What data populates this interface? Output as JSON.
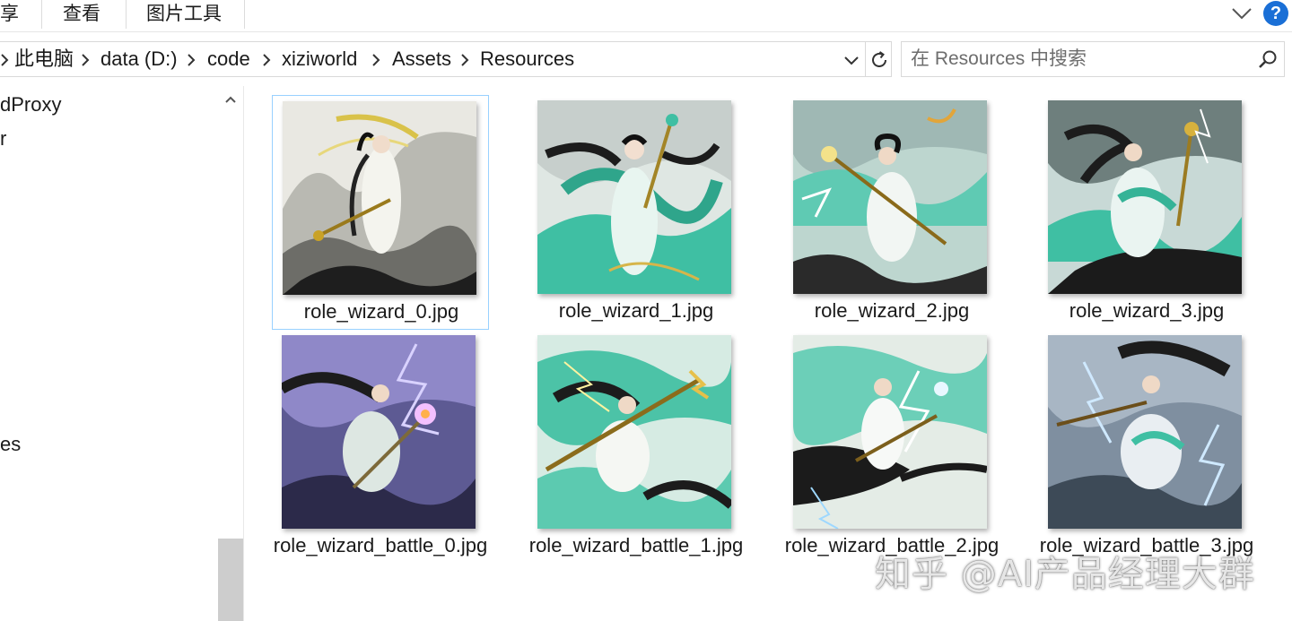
{
  "ribbon": {
    "tabs": [
      "享",
      "查看",
      "图片工具"
    ]
  },
  "address": {
    "breadcrumbs": [
      "此电脑",
      "data (D:)",
      "code",
      "xiziworld",
      "Assets",
      "Resources"
    ]
  },
  "search": {
    "placeholder": "在 Resources 中搜索"
  },
  "nav": {
    "items": [
      "dProxy",
      "r",
      "es"
    ]
  },
  "files": [
    {
      "name": "role_wizard_0.jpg"
    },
    {
      "name": "role_wizard_1.jpg"
    },
    {
      "name": "role_wizard_2.jpg"
    },
    {
      "name": "role_wizard_3.jpg"
    },
    {
      "name": "role_wizard_battle_0.jpg"
    },
    {
      "name": "role_wizard_battle_1.jpg"
    },
    {
      "name": "role_wizard_battle_2.jpg"
    },
    {
      "name": "role_wizard_battle_3.jpg"
    }
  ],
  "watermark": "知乎 @AI产品经理大群",
  "colors": {
    "accent": "#1a6fd6",
    "selection_border": "#99d1ff",
    "jade": "#3fbfa3",
    "ink": "#1c1c1c",
    "lightning": "#8f7cf0"
  }
}
